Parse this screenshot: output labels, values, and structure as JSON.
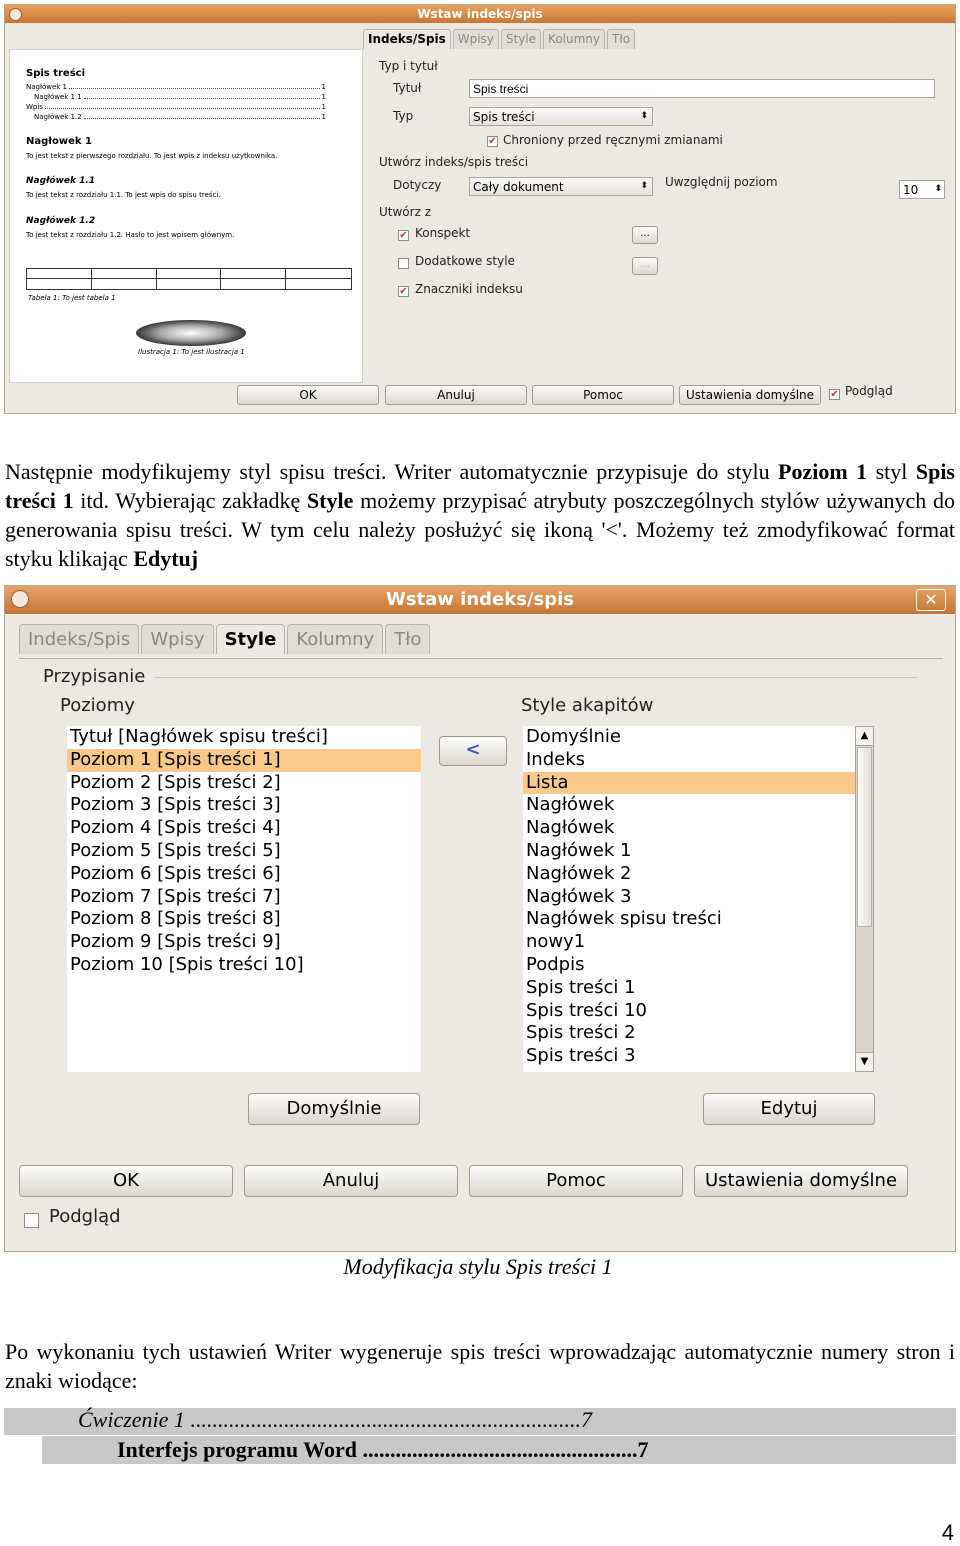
{
  "dialog1": {
    "title": "Wstaw indeks/spis",
    "tabs": [
      "Indeks/Spis",
      "Wpisy",
      "Style",
      "Kolumny",
      "Tło"
    ],
    "preview": {
      "heading": "Spis treści",
      "toc_lines": [
        "Nagłówek 1",
        "Nagłówek 1.1",
        "Wpis",
        "Nagłówek 1.2"
      ],
      "toc_pages": [
        "1",
        "1",
        "1",
        "1"
      ],
      "h1": "Nagłowek 1",
      "t1": "To jest tekst z pierwszego rozdziału. To jest wpis z indeksu użytkownika.",
      "h11": "Nagłówek 1.1",
      "t11": "To jest tekst z rozdziału 1.1. To jest wpis do spisu treści.",
      "h12": "Nagłówek 1.2",
      "t12": "To jest tekst z rozdziału 1.2. Hasło to jest wpisem głównym.",
      "table_caption": "Tabela 1: To jest tabela 1",
      "image_caption": "Ilustracja 1: To jest ilustracja 1"
    },
    "group_type": "Typ i tytuł",
    "title_label": "Tytuł",
    "title_value": "Spis treści",
    "type_label": "Typ",
    "type_value": "Spis treści",
    "protected_label": "Chroniony przed ręcznymi zmianami",
    "group_create": "Utwórz indeks/spis treści",
    "scope_label": "Dotyczy",
    "scope_value": "Cały dokument",
    "level_label": "Uwzględnij poziom",
    "level_value": "10",
    "group_from": "Utwórz z",
    "outline_label": "Konspekt",
    "extra_styles_label": "Dodatkowe style",
    "index_marks_label": "Znaczniki indeksu",
    "dots": "...",
    "buttons": {
      "ok": "OK",
      "cancel": "Anuluj",
      "help": "Pomoc",
      "reset": "Ustawienia domyślne"
    },
    "preview_label": "Podgląd"
  },
  "para1": {
    "t1": "Następnie modyfikujemy styl spisu treści. Writer automatycznie przypisuje do stylu ",
    "b1": "Poziom 1",
    "t2": " styl ",
    "b2": "Spis treści 1",
    "t3": " itd. Wybierając zakładkę ",
    "b3": "Style",
    "t4": " możemy przypisać atrybuty poszczególnych stylów używanych do generowania spisu treści. W tym celu należy posłużyć się ikoną '<'. Możemy też zmodyfikować format styku klikając ",
    "b4": "Edytuj"
  },
  "dialog2": {
    "title": "Wstaw indeks/spis",
    "close": "✕",
    "tabs": [
      "Indeks/Spis",
      "Wpisy",
      "Style",
      "Kolumny",
      "Tło"
    ],
    "group_assign": "Przypisanie",
    "levels_label": "Poziomy",
    "styles_label": "Style akapitów",
    "levels": [
      "Tytuł [Nagłówek spisu treści]",
      "Poziom 1 [Spis treści 1]",
      "Poziom 2 [Spis treści 2]",
      "Poziom 3 [Spis treści 3]",
      "Poziom 4 [Spis treści 4]",
      "Poziom 5 [Spis treści 5]",
      "Poziom 6 [Spis treści 6]",
      "Poziom 7 [Spis treści 7]",
      "Poziom 8 [Spis treści 8]",
      "Poziom 9 [Spis treści 9]",
      "Poziom 10 [Spis treści 10]"
    ],
    "styles": [
      "Domyślnie",
      "Indeks",
      "Lista",
      "Nagłówek",
      "Nagłówek",
      "Nagłówek 1",
      "Nagłówek 2",
      "Nagłówek 3",
      "Nagłówek spisu treści",
      "nowy1",
      "Podpis",
      "Spis treści 1",
      "Spis treści 10",
      "Spis treści 2",
      "Spis treści 3"
    ],
    "assign_button": "<",
    "default_button": "Domyślnie",
    "edit_button": "Edytuj",
    "buttons": {
      "ok": "OK",
      "cancel": "Anuluj",
      "help": "Pomoc",
      "reset": "Ustawienia domyślne"
    },
    "preview_label": "Podgląd"
  },
  "caption": "Modyfikacja stylu Spis treści 1",
  "para2": "Po wykonaniu tych ustawień Writer wygeneruje spis treści wprowadzając automatycznie numery stron i znaki wiodące:",
  "toc": {
    "line1_text": "Ćwiczenie 1",
    "line1_dots": " .......................................................................",
    "line1_page": "7",
    "line2_text": "Interfejs programu Word",
    "line2_dots": " ..................................................",
    "line2_page": "7"
  },
  "page_number": "4"
}
